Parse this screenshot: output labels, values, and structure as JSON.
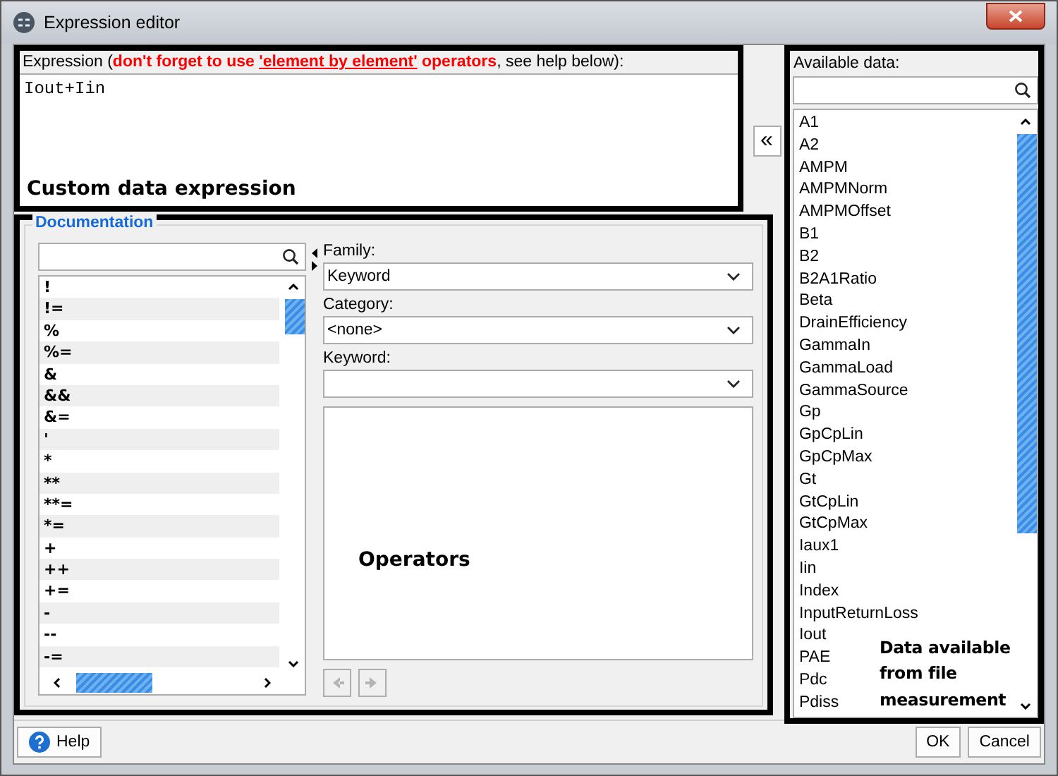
{
  "window": {
    "title": "Expression editor"
  },
  "expression": {
    "label": {
      "before": "Expression (",
      "warning": "don't forget to use ",
      "warning_link": "'element by element'",
      "warning_end": " operators",
      "after": ", see help below):"
    },
    "value": "Iout+Iin",
    "annotation": "Custom data expression"
  },
  "insert_button": {
    "label": "«"
  },
  "documentation": {
    "title": "Documentation",
    "operators": [
      "!",
      "!=",
      "%",
      "%=",
      "&",
      "&&",
      "&=",
      "'",
      "*",
      "**",
      "**=",
      "*=",
      "+",
      "++",
      "+=",
      "-",
      "--",
      "-="
    ],
    "family": {
      "label": "Family:",
      "value": "Keyword"
    },
    "category": {
      "label": "Category:",
      "value": "<none>"
    },
    "keyword": {
      "label": "Keyword:"
    },
    "annotation": "Operators",
    "nav_buttons": [
      {
        "kind": "back",
        "disabled": true
      },
      {
        "kind": "forward",
        "disabled": true
      }
    ]
  },
  "available_data": {
    "label": "Available data:",
    "items": [
      "A1",
      "A2",
      "AMPM",
      "AMPMNorm",
      "AMPMOffset",
      "B1",
      "B2",
      "B2A1Ratio",
      "Beta",
      "DrainEfficiency",
      "GammaIn",
      "GammaLoad",
      "GammaSource",
      "Gp",
      "GpCpLin",
      "GpCpMax",
      "Gt",
      "GtCpLin",
      "GtCpMax",
      "Iaux1",
      "Iin",
      "Index",
      "InputReturnLoss",
      "Iout",
      "PAE",
      "Pdc",
      "Pdiss"
    ],
    "annotation": "Data available from file measurement"
  },
  "footer": {
    "help": "Help",
    "ok": "OK",
    "cancel": "Cancel"
  }
}
